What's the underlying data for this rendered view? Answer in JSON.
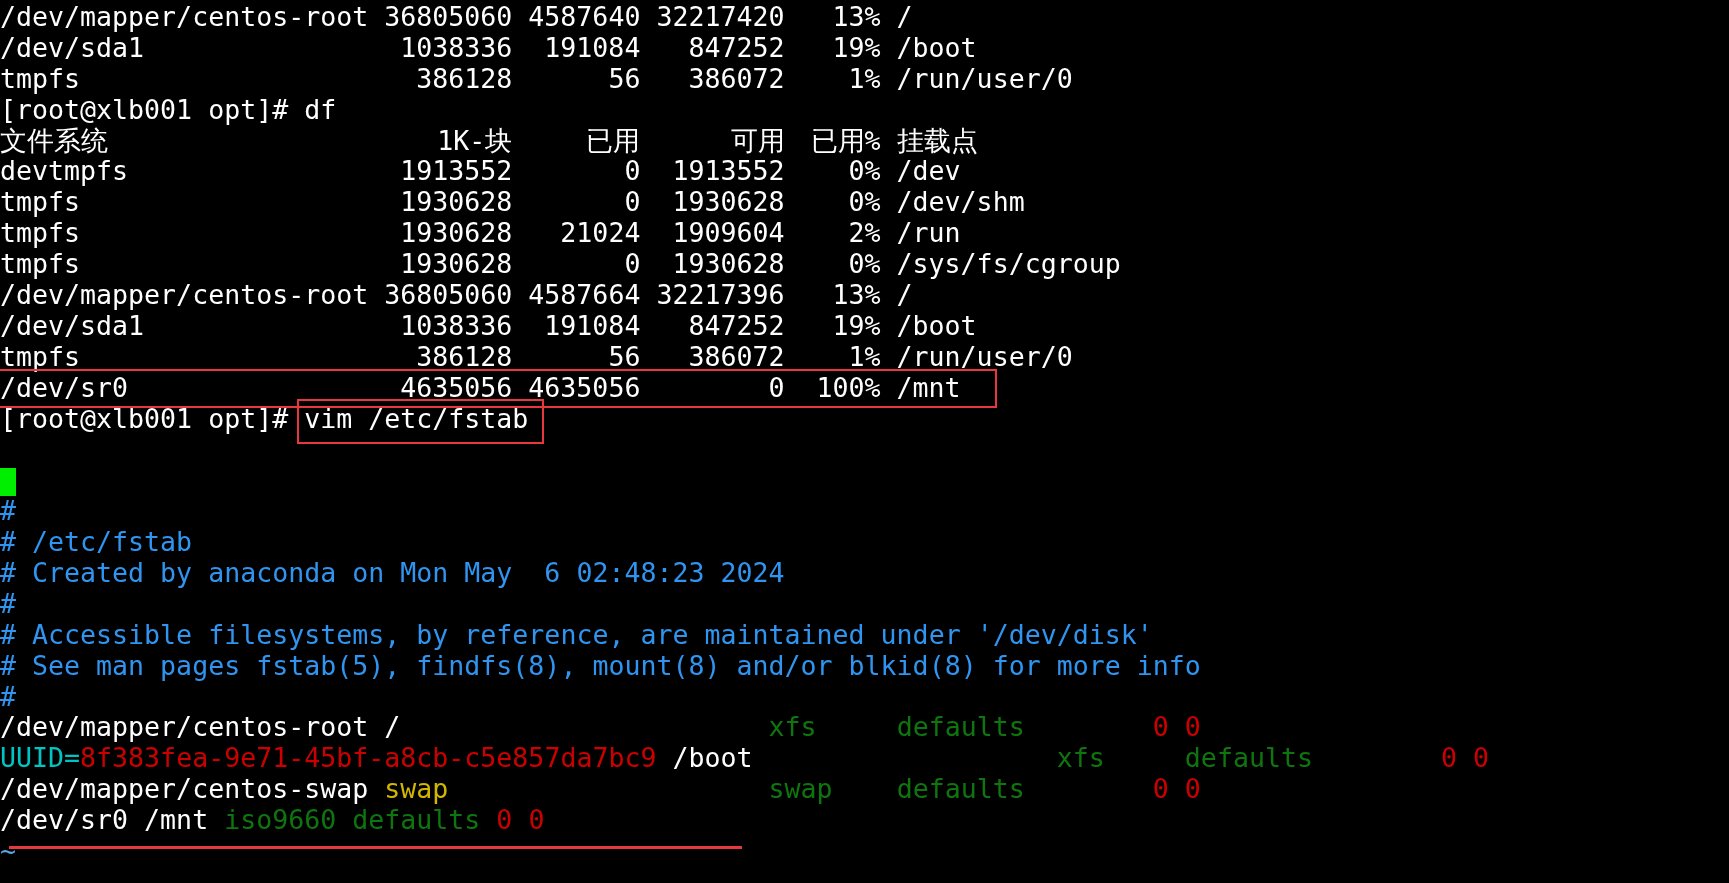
{
  "terminal": {
    "lines": [
      {
        "kind": "df_row",
        "boxed": false,
        "cells": [
          "/dev/mapper/centos-root",
          "36805060",
          "4587640",
          "32217420",
          "13%",
          "/"
        ]
      },
      {
        "kind": "df_row",
        "boxed": false,
        "cells": [
          "/dev/sda1",
          "1038336",
          "191084",
          "847252",
          "19%",
          "/boot"
        ]
      },
      {
        "kind": "df_row",
        "boxed": false,
        "cells": [
          "tmpfs",
          "386128",
          "56",
          "386072",
          "1%",
          "/run/user/0"
        ]
      },
      {
        "kind": "prompt",
        "boxed": false,
        "prompt": "[root@xlb001 opt]#",
        "command": "df"
      },
      {
        "kind": "df_row",
        "boxed": false,
        "cells": [
          "文件系统",
          "1K-块",
          "已用",
          "可用",
          "已用%",
          "挂载点"
        ]
      },
      {
        "kind": "df_row",
        "boxed": false,
        "cells": [
          "devtmpfs",
          "1913552",
          "0",
          "1913552",
          "0%",
          "/dev"
        ]
      },
      {
        "kind": "df_row",
        "boxed": false,
        "cells": [
          "tmpfs",
          "1930628",
          "0",
          "1930628",
          "0%",
          "/dev/shm"
        ]
      },
      {
        "kind": "df_row",
        "boxed": false,
        "cells": [
          "tmpfs",
          "1930628",
          "21024",
          "1909604",
          "2%",
          "/run"
        ]
      },
      {
        "kind": "df_row",
        "boxed": false,
        "cells": [
          "tmpfs",
          "1930628",
          "0",
          "1930628",
          "0%",
          "/sys/fs/cgroup"
        ]
      },
      {
        "kind": "df_row",
        "boxed": false,
        "cells": [
          "/dev/mapper/centos-root",
          "36805060",
          "4587664",
          "32217396",
          "13%",
          "/"
        ]
      },
      {
        "kind": "df_row",
        "boxed": false,
        "cells": [
          "/dev/sda1",
          "1038336",
          "191084",
          "847252",
          "19%",
          "/boot"
        ]
      },
      {
        "kind": "df_row",
        "boxed": false,
        "cells": [
          "tmpfs",
          "386128",
          "56",
          "386072",
          "1%",
          "/run/user/0"
        ]
      },
      {
        "kind": "df_row",
        "boxed": true,
        "cells": [
          "/dev/sr0",
          "4635056",
          "4635056",
          "0",
          "100%",
          "/mnt"
        ]
      },
      {
        "kind": "prompt",
        "boxed": true,
        "prompt": "[root@xlb001 opt]#",
        "command": "vim /etc/fstab"
      },
      {
        "kind": "blank"
      },
      {
        "kind": "cursor"
      },
      {
        "kind": "text",
        "segments": [
          {
            "text": "#",
            "color": "#2f95f0"
          }
        ]
      },
      {
        "kind": "text",
        "segments": [
          {
            "text": "# /etc/fstab",
            "color": "#2f95f0"
          }
        ]
      },
      {
        "kind": "text",
        "segments": [
          {
            "text": "# Created by anaconda on Mon May  6 02:48:23 2024",
            "color": "#2f95f0"
          }
        ]
      },
      {
        "kind": "text",
        "segments": [
          {
            "text": "#",
            "color": "#2f95f0"
          }
        ]
      },
      {
        "kind": "text",
        "segments": [
          {
            "text": "# Accessible filesystems, by reference, are maintained under '/dev/disk'",
            "color": "#2f95f0"
          }
        ]
      },
      {
        "kind": "text",
        "segments": [
          {
            "text": "# See man pages fstab(5), findfs(8), mount(8) and/or blkid(8) for more info",
            "color": "#2f95f0"
          }
        ]
      },
      {
        "kind": "text",
        "segments": [
          {
            "text": "#",
            "color": "#2f95f0"
          }
        ]
      },
      {
        "kind": "text",
        "segments": [
          {
            "text": "/dev/mapper/centos-root /",
            "color": "#ffffff"
          },
          {
            "text": "                       xfs",
            "color": "#0e760e"
          },
          {
            "text": "     defaults",
            "color": "#0e760e"
          },
          {
            "text": "        0 0",
            "color": "#cc0000"
          }
        ]
      },
      {
        "kind": "text",
        "segments": [
          {
            "text": "UUID=",
            "color": "#00c4c4"
          },
          {
            "text": "8f383fea-9e71-45bf-a8cb-c5e857da7bc9",
            "color": "#cc0000"
          },
          {
            "text": " /boot",
            "color": "#ffffff"
          },
          {
            "text": "                   xfs",
            "color": "#0e760e"
          },
          {
            "text": "     defaults",
            "color": "#0e760e"
          },
          {
            "text": "        0 0",
            "color": "#cc0000"
          }
        ]
      },
      {
        "kind": "text",
        "segments": [
          {
            "text": "/dev/mapper/centos-swap",
            "color": "#ffffff"
          },
          {
            "text": " swap",
            "color": "#d2b600"
          },
          {
            "text": "                    swap",
            "color": "#0e760e"
          },
          {
            "text": "    defaults",
            "color": "#0e760e"
          },
          {
            "text": "        0 0",
            "color": "#cc0000"
          }
        ]
      },
      {
        "kind": "text",
        "underlined": true,
        "segments": [
          {
            "text": "/dev/sr0 /mnt",
            "color": "#ffffff"
          },
          {
            "text": " iso9660",
            "color": "#0e760e"
          },
          {
            "text": " defaults",
            "color": "#0e760e"
          },
          {
            "text": " 0 0",
            "color": "#cc0000"
          }
        ]
      },
      {
        "kind": "text",
        "segments": [
          {
            "text": "~",
            "color": "#5aa8e6"
          }
        ]
      }
    ]
  }
}
